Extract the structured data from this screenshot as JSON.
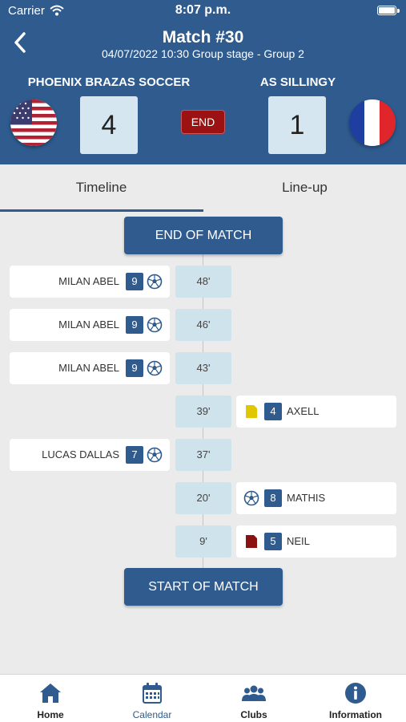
{
  "status_bar": {
    "carrier": "Carrier",
    "time": "8:07 p.m."
  },
  "header": {
    "title": "Match #30",
    "subtitle": "04/07/2022 10:30 Group stage - Group 2",
    "home_team": {
      "name": "PHOENIX BRAZAS SOCCER",
      "score": "4",
      "flag": "usa-flag"
    },
    "away_team": {
      "name": "AS SILLINGY",
      "score": "1",
      "flag": "france-flag"
    },
    "status_badge": "END",
    "colors": {
      "primary": "#2f5b8e",
      "end_badge": "#9c1111",
      "score_bg": "#d6e6f0"
    }
  },
  "tabs": [
    {
      "label": "Timeline",
      "active": true
    },
    {
      "label": "Line-up",
      "active": false
    }
  ],
  "timeline": {
    "end_label": "END OF MATCH",
    "start_label": "START OF MATCH",
    "events": [
      {
        "minute": "48'",
        "side": "home",
        "player": "MILAN ABEL",
        "number": "9",
        "type": "goal",
        "icon": "soccer-ball-icon"
      },
      {
        "minute": "46'",
        "side": "home",
        "player": "MILAN ABEL",
        "number": "9",
        "type": "goal",
        "icon": "soccer-ball-icon"
      },
      {
        "minute": "43'",
        "side": "home",
        "player": "MILAN ABEL",
        "number": "9",
        "type": "goal",
        "icon": "soccer-ball-icon"
      },
      {
        "minute": "39'",
        "side": "away",
        "player": "AXELL",
        "number": "4",
        "type": "yellow-card",
        "icon": "yellow-card-icon",
        "color": "#e0c800"
      },
      {
        "minute": "37'",
        "side": "home",
        "player": "LUCAS DALLAS",
        "number": "7",
        "type": "goal",
        "icon": "soccer-ball-icon"
      },
      {
        "minute": "20'",
        "side": "away",
        "player": "MATHIS",
        "number": "8",
        "type": "goal",
        "icon": "soccer-ball-icon"
      },
      {
        "minute": "9'",
        "side": "away",
        "player": "NEIL",
        "number": "5",
        "type": "red-card",
        "icon": "red-card-icon",
        "color": "#8b1010"
      }
    ]
  },
  "bottom_nav": [
    {
      "label": "Home",
      "icon": "home-icon",
      "active": false
    },
    {
      "label": "Calendar",
      "icon": "calendar-icon",
      "active": true
    },
    {
      "label": "Clubs",
      "icon": "clubs-icon",
      "active": false
    },
    {
      "label": "Information",
      "icon": "info-icon",
      "active": false
    }
  ]
}
